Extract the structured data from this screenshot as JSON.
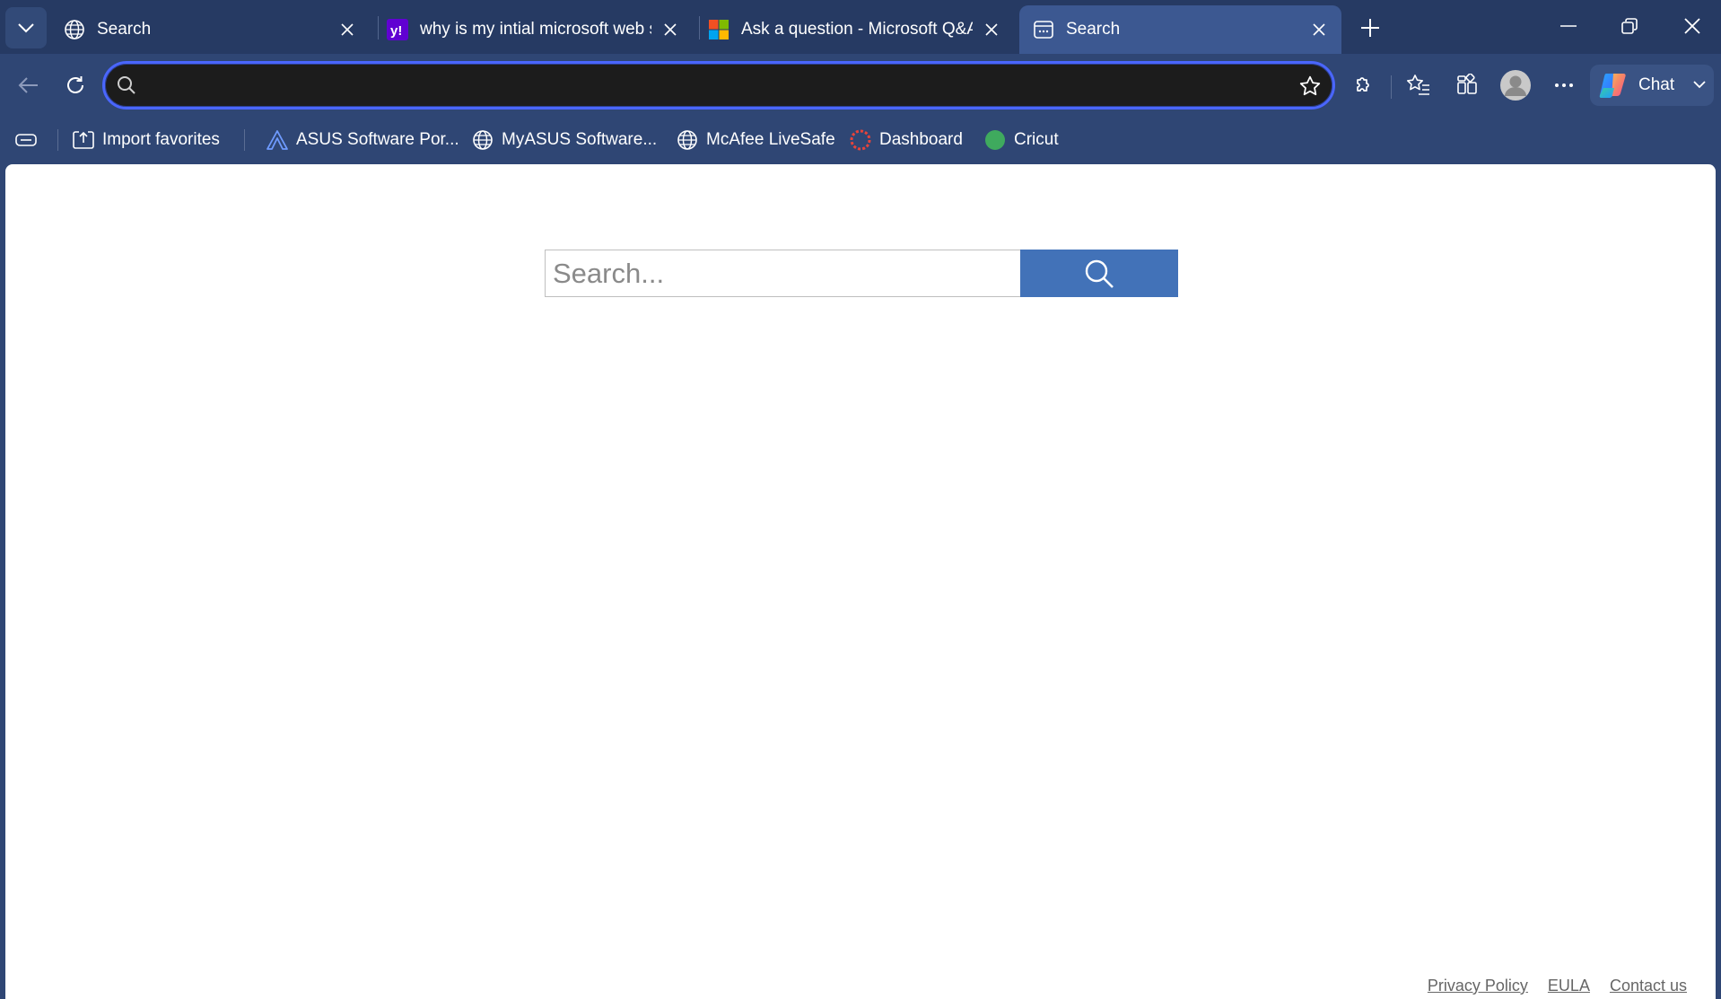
{
  "tabs": [
    {
      "title": "Search",
      "favicon": "globe-icon",
      "active": false
    },
    {
      "title": "why is my intial microsoft web sear",
      "favicon": "yahoo-icon",
      "active": false
    },
    {
      "title": "Ask a question - Microsoft Q&A",
      "favicon": "microsoft-icon",
      "active": false
    },
    {
      "title": "Search",
      "favicon": "page-icon",
      "active": true
    }
  ],
  "address_bar": {
    "value": "",
    "placeholder": ""
  },
  "copilot": {
    "label": "Chat"
  },
  "favorites": [
    {
      "label": "Import favorites",
      "icon": "import-favorites-icon"
    },
    {
      "label": "ASUS Software Por...",
      "icon": "asus-icon"
    },
    {
      "label": "MyASUS Software...",
      "icon": "globe-icon"
    },
    {
      "label": "McAfee LiveSafe",
      "icon": "globe-icon"
    },
    {
      "label": "Dashboard",
      "icon": "dashboard-icon"
    },
    {
      "label": "Cricut",
      "icon": "cricut-icon"
    }
  ],
  "page": {
    "search_placeholder": "Search...",
    "footer_links": [
      "Privacy Policy",
      "EULA",
      "Contact us"
    ]
  },
  "colors": {
    "chrome_bg": "#2f4674",
    "tabstrip_bg": "#263a63",
    "active_tab": "#3c5891",
    "address_border": "#4a66ff",
    "search_button": "#4272b8"
  }
}
